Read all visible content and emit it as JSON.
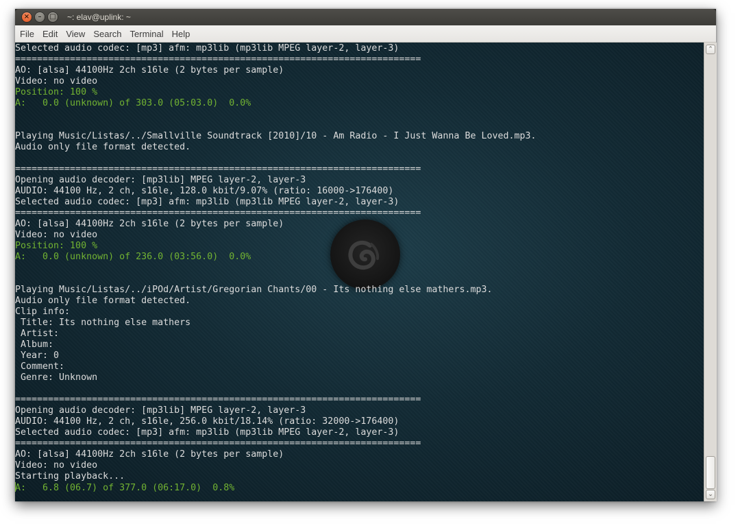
{
  "window": {
    "title": "~: elav@uplink: ~",
    "close_glyph": "×",
    "min_glyph": "–",
    "max_glyph": "□"
  },
  "menu": [
    "File",
    "Edit",
    "View",
    "Search",
    "Terminal",
    "Help"
  ],
  "terminal": {
    "background_icon": "debian-swirl-logo",
    "lines": [
      {
        "text": "Selected audio codec: [mp3] afm: mp3lib (mp3lib MPEG layer-2, layer-3)",
        "color": "white"
      },
      {
        "text": "==========================================================================",
        "color": "white"
      },
      {
        "text": "AO: [alsa] 44100Hz 2ch s16le (2 bytes per sample)",
        "color": "white"
      },
      {
        "text": "Video: no video",
        "color": "white"
      },
      {
        "text": "Position: 100 %",
        "color": "green"
      },
      {
        "text": "A:   0.0 (unknown) of 303.0 (05:03.0)  0.0%",
        "color": "green"
      },
      {
        "text": "",
        "color": "white"
      },
      {
        "text": "",
        "color": "white"
      },
      {
        "text": "Playing Music/Listas/../Smallville Soundtrack [2010]/10 - Am Radio - I Just Wanna Be Loved.mp3.",
        "color": "white"
      },
      {
        "text": "Audio only file format detected.",
        "color": "white"
      },
      {
        "text": "",
        "color": "white"
      },
      {
        "text": "==========================================================================",
        "color": "white"
      },
      {
        "text": "Opening audio decoder: [mp3lib] MPEG layer-2, layer-3",
        "color": "white"
      },
      {
        "text": "AUDIO: 44100 Hz, 2 ch, s16le, 128.0 kbit/9.07% (ratio: 16000->176400)",
        "color": "white"
      },
      {
        "text": "Selected audio codec: [mp3] afm: mp3lib (mp3lib MPEG layer-2, layer-3)",
        "color": "white"
      },
      {
        "text": "==========================================================================",
        "color": "white"
      },
      {
        "text": "AO: [alsa] 44100Hz 2ch s16le (2 bytes per sample)",
        "color": "white"
      },
      {
        "text": "Video: no video",
        "color": "white"
      },
      {
        "text": "Position: 100 %",
        "color": "green"
      },
      {
        "text": "A:   0.0 (unknown) of 236.0 (03:56.0)  0.0%",
        "color": "green"
      },
      {
        "text": "",
        "color": "white"
      },
      {
        "text": "",
        "color": "white"
      },
      {
        "text": "Playing Music/Listas/../iPOd/Artist/Gregorian Chants/00 - Its nothing else mathers.mp3.",
        "color": "white"
      },
      {
        "text": "Audio only file format detected.",
        "color": "white"
      },
      {
        "text": "Clip info:",
        "color": "white"
      },
      {
        "text": " Title: Its nothing else mathers",
        "color": "white"
      },
      {
        "text": " Artist: ",
        "color": "white"
      },
      {
        "text": " Album: ",
        "color": "white"
      },
      {
        "text": " Year: 0",
        "color": "white"
      },
      {
        "text": " Comment: ",
        "color": "white"
      },
      {
        "text": " Genre: Unknown",
        "color": "white"
      },
      {
        "text": "",
        "color": "white"
      },
      {
        "text": "==========================================================================",
        "color": "white"
      },
      {
        "text": "Opening audio decoder: [mp3lib] MPEG layer-2, layer-3",
        "color": "white"
      },
      {
        "text": "AUDIO: 44100 Hz, 2 ch, s16le, 256.0 kbit/18.14% (ratio: 32000->176400)",
        "color": "white"
      },
      {
        "text": "Selected audio codec: [mp3] afm: mp3lib (mp3lib MPEG layer-2, layer-3)",
        "color": "white"
      },
      {
        "text": "==========================================================================",
        "color": "white"
      },
      {
        "text": "AO: [alsa] 44100Hz 2ch s16le (2 bytes per sample)",
        "color": "white"
      },
      {
        "text": "Video: no video",
        "color": "white"
      },
      {
        "text": "Starting playback...",
        "color": "white"
      },
      {
        "text": "A:   6.8 (06.7) of 377.0 (06:17.0)  0.8%",
        "color": "green",
        "cursor": true
      }
    ]
  },
  "scrollbar": {
    "up_glyph": "⌃",
    "down_glyph": "⌄"
  },
  "colors": {
    "terminal_text": "#dcdcdc",
    "terminal_green": "#72b332",
    "close_button": "#e0521f"
  }
}
